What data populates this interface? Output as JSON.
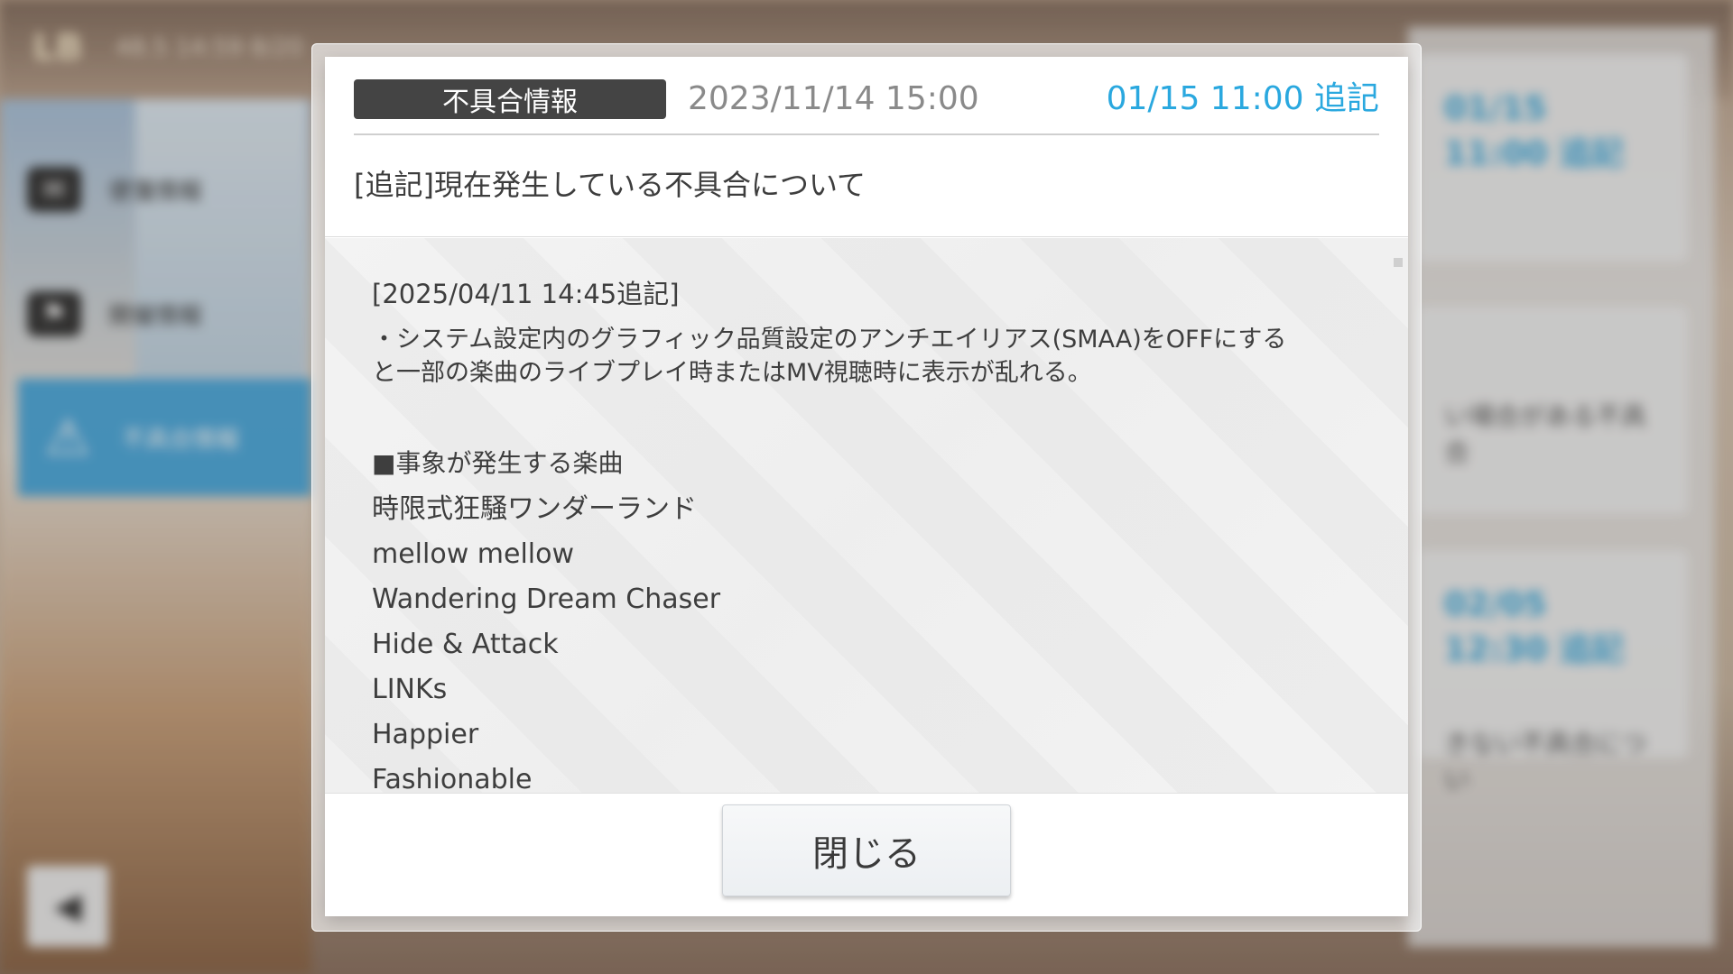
{
  "background": {
    "level_badge": "LB",
    "status_text": "48.5 14:59  8/20",
    "nav": [
      {
        "label": "便箋情報",
        "icon": "mail-icon"
      },
      {
        "label": "開催情報",
        "icon": "flag-icon"
      },
      {
        "label": "不具合情報",
        "icon": "warning-icon"
      }
    ],
    "cards": [
      {
        "when": "01/15 11:00 追記",
        "text": ""
      },
      {
        "when": "",
        "text": "い場合がある不具合"
      },
      {
        "when": "02/05 12:30 追記",
        "text": "きない不具合につい"
      }
    ]
  },
  "dialog": {
    "category": "不具合情報",
    "date": "2023/11/14 15:00",
    "updated": "01/15 11:00 追記",
    "title": "[追記]現在発生している不具合について",
    "body": {
      "addendum_stamp": "[2025/04/11 14:45追記]",
      "paragraph_line1": "・システム設定内のグラフィック品質設定のアンチエイリアス(SMAA)をOFFにする",
      "paragraph_line2": "と一部の楽曲のライブプレイ時またはMV視聴時に表示が乱れる。",
      "section_heading": "■事象が発生する楽曲",
      "songs": [
        "時限式狂騒ワンダーランド",
        "mellow mellow",
        "Wandering Dream Chaser",
        "Hide & Attack",
        "LINKs",
        "Happier",
        "Fashionable"
      ]
    },
    "close_label": "閉じる"
  }
}
